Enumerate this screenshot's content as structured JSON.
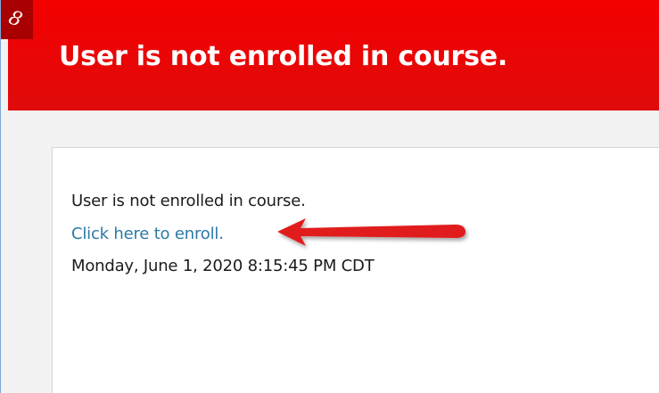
{
  "banner": {
    "title": "User is not enrolled in course.",
    "icon": "link-icon",
    "icon_glyph": "ℐ",
    "color": "#f40000"
  },
  "message": {
    "text": "User is not enrolled in course.",
    "link_text": "Click here to enroll.",
    "timestamp": "Monday, June 1, 2020 8:15:45 PM CDT",
    "link_color": "#2d79a6"
  },
  "annotation": {
    "arrow_color": "#e11b1b"
  }
}
